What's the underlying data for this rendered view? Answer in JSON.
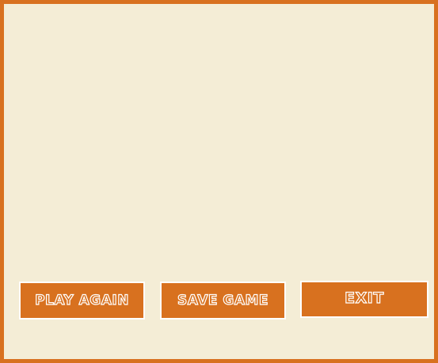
{
  "buttons": {
    "play_again": "Play Again",
    "save_game": "Save Game",
    "exit": "Exit"
  },
  "colors": {
    "accent": "#d8711f",
    "background": "#f4edd6",
    "button_outline": "#ffffff"
  }
}
